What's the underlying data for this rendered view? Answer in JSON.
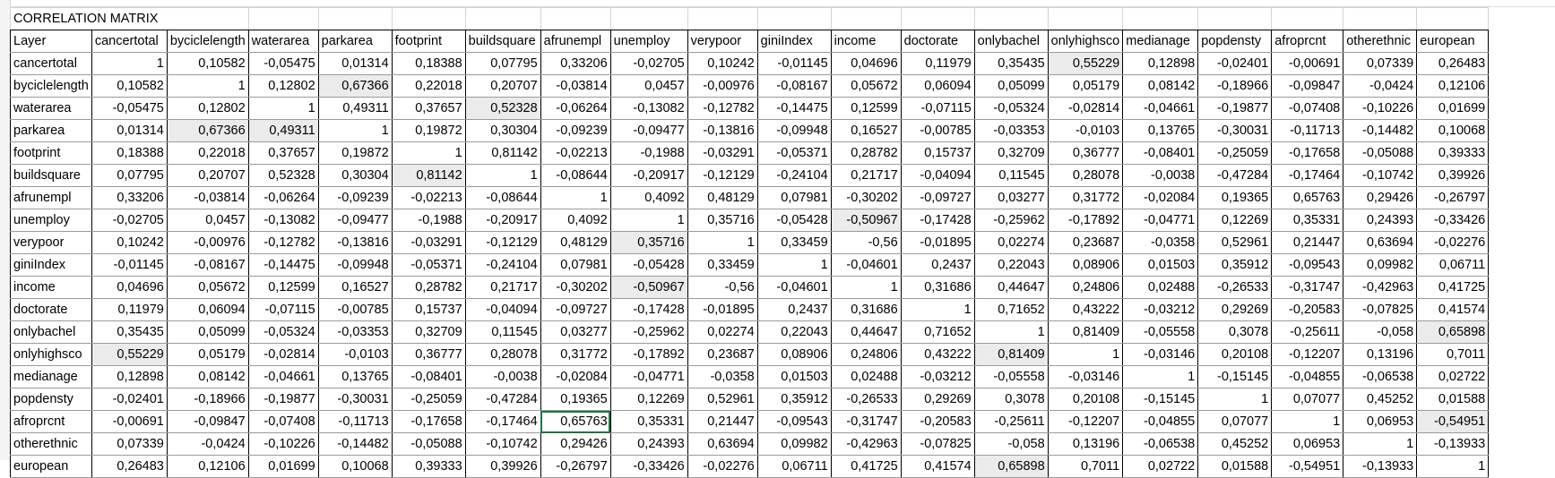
{
  "sheet": {
    "title": "CORRELATION MATRIX",
    "corner_label": "Layer",
    "columns": [
      "cancertotal",
      "byciclelength",
      "waterarea",
      "parkarea",
      "footprint",
      "buildsquare",
      "afrunempl",
      "unemploy",
      "verypoor",
      "giniIndex",
      "income",
      "doctorate",
      "onlybachel",
      "onlyhighsco",
      "medianage",
      "popdensty",
      "afroprcnt",
      "otherethnic",
      "european"
    ],
    "rows": [
      {
        "label": "cancertotal",
        "values": [
          "1",
          "0,10582",
          "-0,05475",
          "0,01314",
          "0,18388",
          "0,07795",
          "0,33206",
          "-0,02705",
          "0,10242",
          "-0,01145",
          "0,04696",
          "0,11979",
          "0,35435",
          "0,55229",
          "0,12898",
          "-0,02401",
          "-0,00691",
          "0,07339",
          "0,26483"
        ]
      },
      {
        "label": "byciclelength",
        "values": [
          "0,10582",
          "1",
          "0,12802",
          "0,67366",
          "0,22018",
          "0,20707",
          "-0,03814",
          "0,0457",
          "-0,00976",
          "-0,08167",
          "0,05672",
          "0,06094",
          "0,05099",
          "0,05179",
          "0,08142",
          "-0,18966",
          "-0,09847",
          "-0,0424",
          "0,12106"
        ]
      },
      {
        "label": "waterarea",
        "values": [
          "-0,05475",
          "0,12802",
          "1",
          "0,49311",
          "0,37657",
          "0,52328",
          "-0,06264",
          "-0,13082",
          "-0,12782",
          "-0,14475",
          "0,12599",
          "-0,07115",
          "-0,05324",
          "-0,02814",
          "-0,04661",
          "-0,19877",
          "-0,07408",
          "-0,10226",
          "0,01699"
        ]
      },
      {
        "label": "parkarea",
        "values": [
          "0,01314",
          "0,67366",
          "0,49311",
          "1",
          "0,19872",
          "0,30304",
          "-0,09239",
          "-0,09477",
          "-0,13816",
          "-0,09948",
          "0,16527",
          "-0,00785",
          "-0,03353",
          "-0,0103",
          "0,13765",
          "-0,30031",
          "-0,11713",
          "-0,14482",
          "0,10068"
        ]
      },
      {
        "label": "footprint",
        "values": [
          "0,18388",
          "0,22018",
          "0,37657",
          "0,19872",
          "1",
          "0,81142",
          "-0,02213",
          "-0,1988",
          "-0,03291",
          "-0,05371",
          "0,28782",
          "0,15737",
          "0,32709",
          "0,36777",
          "-0,08401",
          "-0,25059",
          "-0,17658",
          "-0,05088",
          "0,39333"
        ]
      },
      {
        "label": "buildsquare",
        "values": [
          "0,07795",
          "0,20707",
          "0,52328",
          "0,30304",
          "0,81142",
          "1",
          "-0,08644",
          "-0,20917",
          "-0,12129",
          "-0,24104",
          "0,21717",
          "-0,04094",
          "0,11545",
          "0,28078",
          "-0,0038",
          "-0,47284",
          "-0,17464",
          "-0,10742",
          "0,39926"
        ]
      },
      {
        "label": "afrunempl",
        "values": [
          "0,33206",
          "-0,03814",
          "-0,06264",
          "-0,09239",
          "-0,02213",
          "-0,08644",
          "1",
          "0,4092",
          "0,48129",
          "0,07981",
          "-0,30202",
          "-0,09727",
          "0,03277",
          "0,31772",
          "-0,02084",
          "0,19365",
          "0,65763",
          "0,29426",
          "-0,26797"
        ]
      },
      {
        "label": "unemploy",
        "values": [
          "-0,02705",
          "0,0457",
          "-0,13082",
          "-0,09477",
          "-0,1988",
          "-0,20917",
          "0,4092",
          "1",
          "0,35716",
          "-0,05428",
          "-0,50967",
          "-0,17428",
          "-0,25962",
          "-0,17892",
          "-0,04771",
          "0,12269",
          "0,35331",
          "0,24393",
          "-0,33426"
        ]
      },
      {
        "label": "verypoor",
        "values": [
          "0,10242",
          "-0,00976",
          "-0,12782",
          "-0,13816",
          "-0,03291",
          "-0,12129",
          "0,48129",
          "0,35716",
          "1",
          "0,33459",
          "-0,56",
          "-0,01895",
          "0,02274",
          "0,23687",
          "-0,0358",
          "0,52961",
          "0,21447",
          "0,63694",
          "-0,02276"
        ]
      },
      {
        "label": "giniIndex",
        "values": [
          "-0,01145",
          "-0,08167",
          "-0,14475",
          "-0,09948",
          "-0,05371",
          "-0,24104",
          "0,07981",
          "-0,05428",
          "0,33459",
          "1",
          "-0,04601",
          "0,2437",
          "0,22043",
          "0,08906",
          "0,01503",
          "0,35912",
          "-0,09543",
          "0,09982",
          "0,06711"
        ]
      },
      {
        "label": "income",
        "values": [
          "0,04696",
          "0,05672",
          "0,12599",
          "0,16527",
          "0,28782",
          "0,21717",
          "-0,30202",
          "-0,50967",
          "-0,56",
          "-0,04601",
          "1",
          "0,31686",
          "0,44647",
          "0,24806",
          "0,02488",
          "-0,26533",
          "-0,31747",
          "-0,42963",
          "0,41725"
        ]
      },
      {
        "label": "doctorate",
        "values": [
          "0,11979",
          "0,06094",
          "-0,07115",
          "-0,00785",
          "0,15737",
          "-0,04094",
          "-0,09727",
          "-0,17428",
          "-0,01895",
          "0,2437",
          "0,31686",
          "1",
          "0,71652",
          "0,43222",
          "-0,03212",
          "0,29269",
          "-0,20583",
          "-0,07825",
          "0,41574"
        ]
      },
      {
        "label": "onlybachel",
        "values": [
          "0,35435",
          "0,05099",
          "-0,05324",
          "-0,03353",
          "0,32709",
          "0,11545",
          "0,03277",
          "-0,25962",
          "0,02274",
          "0,22043",
          "0,44647",
          "0,71652",
          "1",
          "0,81409",
          "-0,05558",
          "0,3078",
          "-0,25611",
          "-0,058",
          "0,65898"
        ]
      },
      {
        "label": "onlyhighsco",
        "values": [
          "0,55229",
          "0,05179",
          "-0,02814",
          "-0,0103",
          "0,36777",
          "0,28078",
          "0,31772",
          "-0,17892",
          "0,23687",
          "0,08906",
          "0,24806",
          "0,43222",
          "0,81409",
          "1",
          "-0,03146",
          "0,20108",
          "-0,12207",
          "0,13196",
          "0,7011"
        ]
      },
      {
        "label": "medianage",
        "values": [
          "0,12898",
          "0,08142",
          "-0,04661",
          "0,13765",
          "-0,08401",
          "-0,0038",
          "-0,02084",
          "-0,04771",
          "-0,0358",
          "0,01503",
          "0,02488",
          "-0,03212",
          "-0,05558",
          "-0,03146",
          "1",
          "-0,15145",
          "-0,04855",
          "-0,06538",
          "0,02722"
        ]
      },
      {
        "label": "popdensty",
        "values": [
          "-0,02401",
          "-0,18966",
          "-0,19877",
          "-0,30031",
          "-0,25059",
          "-0,47284",
          "0,19365",
          "0,12269",
          "0,52961",
          "0,35912",
          "-0,26533",
          "0,29269",
          "0,3078",
          "0,20108",
          "-0,15145",
          "1",
          "0,07077",
          "0,45252",
          "0,01588"
        ]
      },
      {
        "label": "afroprcnt",
        "values": [
          "-0,00691",
          "-0,09847",
          "-0,07408",
          "-0,11713",
          "-0,17658",
          "-0,17464",
          "0,65763",
          "0,35331",
          "0,21447",
          "-0,09543",
          "-0,31747",
          "-0,20583",
          "-0,25611",
          "-0,12207",
          "-0,04855",
          "0,07077",
          "1",
          "0,06953",
          "-0,54951"
        ]
      },
      {
        "label": "otherethnic",
        "values": [
          "0,07339",
          "-0,0424",
          "-0,10226",
          "-0,14482",
          "-0,05088",
          "-0,10742",
          "0,29426",
          "0,24393",
          "0,63694",
          "0,09982",
          "-0,42963",
          "-0,07825",
          "-0,058",
          "0,13196",
          "-0,06538",
          "0,45252",
          "0,06953",
          "1",
          "-0,13933"
        ]
      },
      {
        "label": "european",
        "values": [
          "0,26483",
          "0,12106",
          "0,01699",
          "0,10068",
          "0,39333",
          "0,39926",
          "-0,26797",
          "-0,33426",
          "-0,02276",
          "0,06711",
          "0,41725",
          "0,41574",
          "0,65898",
          "0,7011",
          "0,02722",
          "0,01588",
          "-0,54951",
          "-0,13933",
          "1"
        ]
      }
    ],
    "highlights": [
      [
        0,
        13
      ],
      [
        1,
        3
      ],
      [
        2,
        5
      ],
      [
        3,
        1
      ],
      [
        3,
        2
      ],
      [
        5,
        4
      ],
      [
        7,
        10
      ],
      [
        8,
        7
      ],
      [
        10,
        7
      ],
      [
        12,
        18
      ],
      [
        13,
        0
      ],
      [
        13,
        12
      ],
      [
        16,
        18
      ],
      [
        18,
        12
      ]
    ],
    "selected_cell": [
      16,
      6
    ],
    "colors": {
      "highlight": "#ebebeb",
      "selection": "#217346",
      "gridline": "#d4d4d4"
    }
  }
}
